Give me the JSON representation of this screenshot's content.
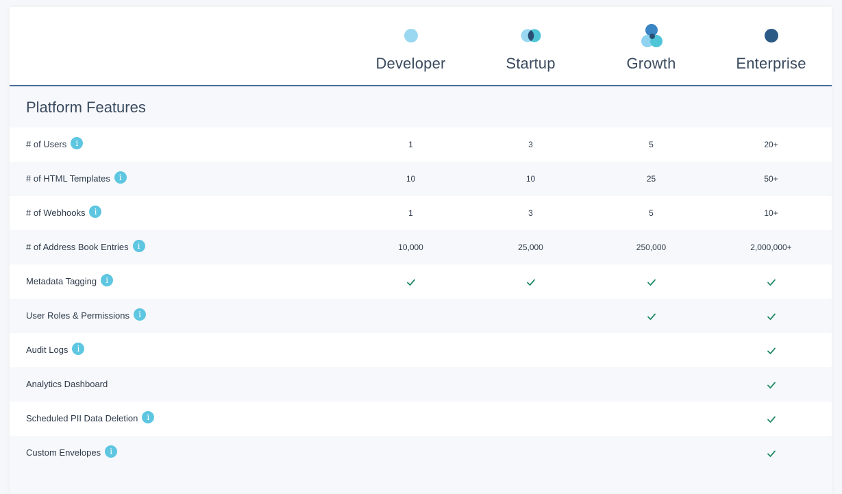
{
  "plans": [
    {
      "name": "Developer",
      "icon": "single-light-circle-icon"
    },
    {
      "name": "Startup",
      "icon": "two-circles-icon"
    },
    {
      "name": "Growth",
      "icon": "three-circles-icon"
    },
    {
      "name": "Enterprise",
      "icon": "dark-circle-icon"
    }
  ],
  "section": {
    "title": "Platform Features"
  },
  "rows": [
    {
      "label": "# of Users",
      "info": "i",
      "values": [
        "1",
        "3",
        "5",
        "20+"
      ]
    },
    {
      "label": "# of HTML Templates",
      "info": "i",
      "values": [
        "10",
        "10",
        "25",
        "50+"
      ]
    },
    {
      "label": "# of Webhooks",
      "info": "i",
      "values": [
        "1",
        "3",
        "5",
        "10+"
      ]
    },
    {
      "label": "# of Address Book Entries",
      "info": "i",
      "values": [
        "10,000",
        "25,000",
        "250,000",
        "2,000,000+"
      ]
    },
    {
      "label": "Metadata Tagging",
      "info": "i",
      "checks": [
        true,
        true,
        true,
        true
      ]
    },
    {
      "label": "User Roles & Permissions",
      "info": "i",
      "checks": [
        false,
        false,
        true,
        true
      ]
    },
    {
      "label": "Audit Logs",
      "info": "i",
      "checks": [
        false,
        false,
        false,
        true
      ]
    },
    {
      "label": "Analytics Dashboard",
      "info": "",
      "checks": [
        false,
        false,
        false,
        true
      ]
    },
    {
      "label": "Scheduled PII Data Deletion",
      "info": "i",
      "checks": [
        false,
        false,
        false,
        true
      ]
    },
    {
      "label": "Custom Envelopes",
      "info": "i",
      "checks": [
        false,
        false,
        false,
        true
      ]
    }
  ],
  "colors": {
    "accent_line": "#4a6a9a",
    "check": "#1f8a63",
    "info_badge": "#5ec6e0"
  }
}
